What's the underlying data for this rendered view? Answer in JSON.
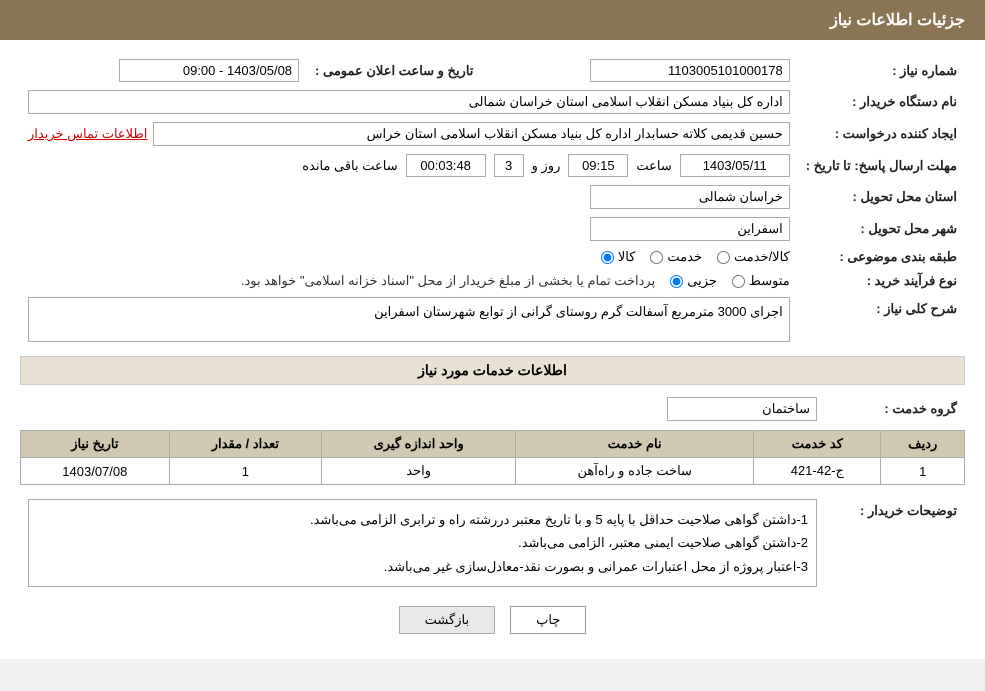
{
  "header": {
    "title": "جزئیات اطلاعات نیاز"
  },
  "fields": {
    "need_number_label": "شماره نیاز :",
    "need_number_value": "1103005101000178",
    "buyer_org_label": "نام دستگاه خریدار :",
    "buyer_org_value": "اداره کل بنیاد مسکن انقلاب اسلامی استان خراسان شمالی",
    "creator_label": "ایجاد کننده درخواست :",
    "creator_value": "حسین قدیمی کلاته حسابدار اداره کل بنیاد مسکن انقلاب اسلامی استان خراس",
    "creator_link": "اطلاعات تماس خریدار",
    "announce_datetime_label": "تاریخ و ساعت اعلان عمومی :",
    "announce_datetime_value": "1403/05/08 - 09:00",
    "response_deadline_label": "مهلت ارسال پاسخ: تا تاریخ :",
    "response_date": "1403/05/11",
    "response_time_label": "ساعت",
    "response_time": "09:15",
    "response_day_label": "روز و",
    "response_days": "3",
    "remaining_label": "ساعت باقی مانده",
    "remaining_time": "00:03:48",
    "delivery_province_label": "استان محل تحویل :",
    "delivery_province_value": "خراسان شمالی",
    "delivery_city_label": "شهر محل تحویل :",
    "delivery_city_value": "اسفراین",
    "category_label": "طبقه بندی موضوعی :",
    "category_options": [
      "کالا",
      "خدمت",
      "کالا/خدمت"
    ],
    "category_selected": "کالا",
    "purchase_type_label": "نوع فرآیند خرید :",
    "purchase_type_options": [
      "جزیی",
      "متوسط"
    ],
    "purchase_type_note": "پرداخت تمام یا بخشی از مبلغ خریدار از محل \"اسناد خزانه اسلامی\" خواهد بود.",
    "need_desc_label": "شرح کلی نیاز :",
    "need_desc_value": "اجرای 3000 مترمربع آسفالت گرم روستای گرانی از توابع شهرستان اسفراین"
  },
  "services_section": {
    "title": "اطلاعات خدمات مورد نیاز",
    "service_group_label": "گروه خدمت :",
    "service_group_value": "ساختمان",
    "table_headers": [
      "ردیف",
      "کد خدمت",
      "نام خدمت",
      "واحد اندازه گیری",
      "تعداد / مقدار",
      "تاریخ نیاز"
    ],
    "table_rows": [
      {
        "row": "1",
        "code": "ج-42-421",
        "name": "ساخت جاده و راه‌آهن",
        "unit": "واحد",
        "quantity": "1",
        "date": "1403/07/08"
      }
    ]
  },
  "notes": {
    "label": "توضیحات خریدار :",
    "lines": [
      "1-داشتن گواهی صلاحیت حداقل با پایه 5 و با تاریخ معتبر دررشته راه و ترابری الزامی می‌باشد.",
      "2-داشتن گواهی صلاحیت ایمنی معتبر، الزامی می‌باشد.",
      "3-اعتبار پروژه از محل اعتبارات عمرانی و بصورت نقد-معادل‌سازی غیر می‌باشد."
    ]
  },
  "buttons": {
    "back_label": "بازگشت",
    "print_label": "چاپ"
  }
}
